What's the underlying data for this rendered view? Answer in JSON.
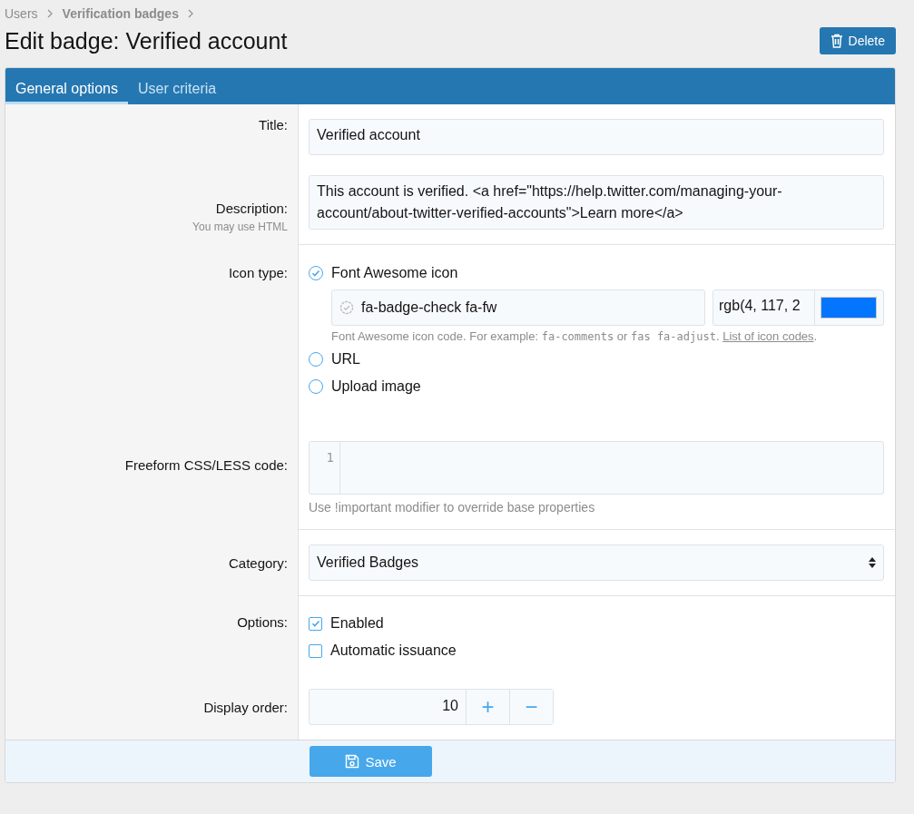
{
  "breadcrumb": [
    {
      "label": "Users",
      "current": false
    },
    {
      "label": "Verification badges",
      "current": true
    }
  ],
  "title": "Edit badge: Verified account",
  "delete_button": "Delete",
  "tabs": [
    {
      "label": "General options",
      "selected": true
    },
    {
      "label": "User criteria",
      "selected": false
    }
  ],
  "fields": {
    "title": {
      "label": "Title:",
      "value": "Verified account"
    },
    "description": {
      "label": "Description:",
      "hint": "You may use HTML",
      "value": "This account is verified. <a href=\"https://help.twitter.com/managing-your-account/about-twitter-verified-accounts\">Learn more</a>"
    },
    "icon_type": {
      "label": "Icon type:",
      "options": [
        {
          "label": "Font Awesome icon",
          "selected": true
        },
        {
          "label": "URL",
          "selected": false
        },
        {
          "label": "Upload image",
          "selected": false
        }
      ],
      "icon_code": "fa-badge-check fa-fw",
      "color_value": "rgb(4, 117, 2",
      "color": "#0475fe",
      "help": [
        {
          "kind": "text",
          "text": "Font Awesome icon code. For example: "
        },
        {
          "kind": "code",
          "text": "fa-comments"
        },
        {
          "kind": "text",
          "text": " or "
        },
        {
          "kind": "code",
          "text": "fas fa-adjust"
        },
        {
          "kind": "text",
          "text": ". "
        },
        {
          "kind": "link",
          "text": "List of icon codes"
        },
        {
          "kind": "text",
          "text": "."
        }
      ]
    },
    "css": {
      "label": "Freeform CSS/LESS code:",
      "line_number": "1",
      "hint": "Use !important modifier to override base properties"
    },
    "category": {
      "label": "Category:",
      "value": "Verified Badges"
    },
    "options": {
      "label": "Options:",
      "items": [
        {
          "label": "Enabled",
          "checked": true
        },
        {
          "label": "Automatic issuance",
          "checked": false
        }
      ]
    },
    "display_order": {
      "label": "Display order:",
      "value": "10",
      "plus": "+",
      "minus": "−"
    }
  },
  "save_button": "Save"
}
